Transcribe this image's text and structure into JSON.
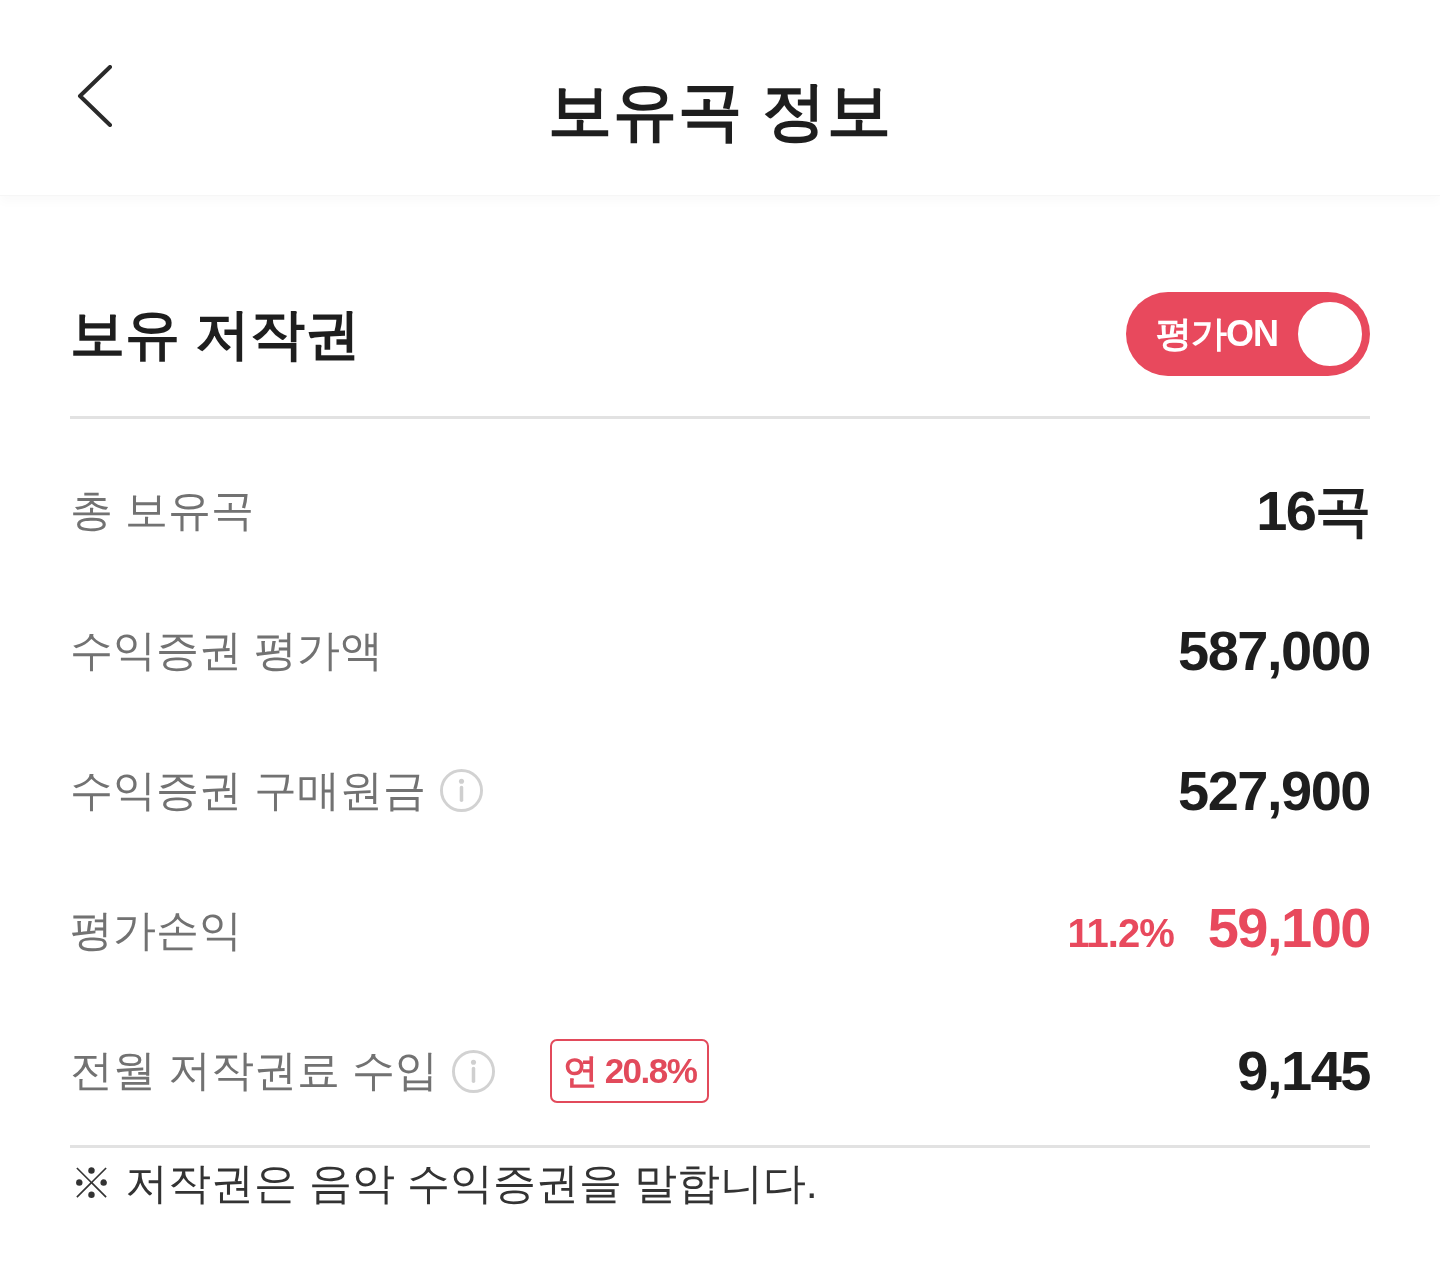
{
  "header": {
    "title": "보유곡 정보"
  },
  "section": {
    "title": "보유 저작권",
    "toggle": {
      "label": "평가ON",
      "on": true
    }
  },
  "rows": [
    {
      "label": "총 보유곡",
      "info": false,
      "value": "16곡",
      "highlight": false
    },
    {
      "label": "수익증권 평가액",
      "info": false,
      "value": "587,000",
      "highlight": false
    },
    {
      "label": "수익증권 구매원금",
      "info": true,
      "value": "527,900",
      "highlight": false
    },
    {
      "label": "평가손익",
      "info": false,
      "rate": "11.2%",
      "value": "59,100",
      "highlight": true
    },
    {
      "label": "전월 저작권료 수입",
      "info": true,
      "badge": "연 20.8%",
      "value": "9,145",
      "highlight": false
    }
  ],
  "footnote": "※ 저작권은 음악 수익증권을 말합니다."
}
